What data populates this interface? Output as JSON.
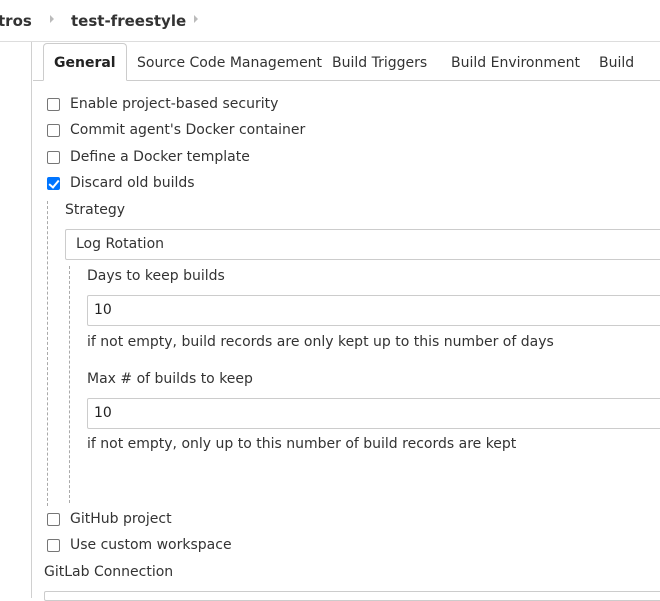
{
  "breadcrumb": {
    "prev": "tros",
    "current": "test-freestyle"
  },
  "tabs": [
    {
      "label": "General",
      "active": true
    },
    {
      "label": "Source Code Management",
      "active": false
    },
    {
      "label": "Build Triggers",
      "active": false
    },
    {
      "label": "Build Environment",
      "active": false
    },
    {
      "label": "Build",
      "active": false
    }
  ],
  "options_top": [
    {
      "label": "Enable project-based security",
      "checked": false
    },
    {
      "label": "Commit agent's Docker container",
      "checked": false
    },
    {
      "label": "Define a Docker template",
      "checked": false
    },
    {
      "label": "Discard old builds",
      "checked": true
    }
  ],
  "discard": {
    "strategy_label": "Strategy",
    "strategy_value": "Log Rotation",
    "days_label": "Days to keep builds",
    "days_value": "10",
    "days_help": "if not empty, build records are only kept up to this number of days",
    "max_label": "Max # of builds to keep",
    "max_value": "10",
    "max_help": "if not empty, only up to this number of build records are kept"
  },
  "options_bottom": [
    {
      "label": "GitHub project",
      "checked": false
    },
    {
      "label": "Use custom workspace",
      "checked": false
    }
  ],
  "gitlab_label": "GitLab Connection",
  "colors": {
    "accent": "#0075ff",
    "border": "#cccccc",
    "text": "#333333"
  }
}
